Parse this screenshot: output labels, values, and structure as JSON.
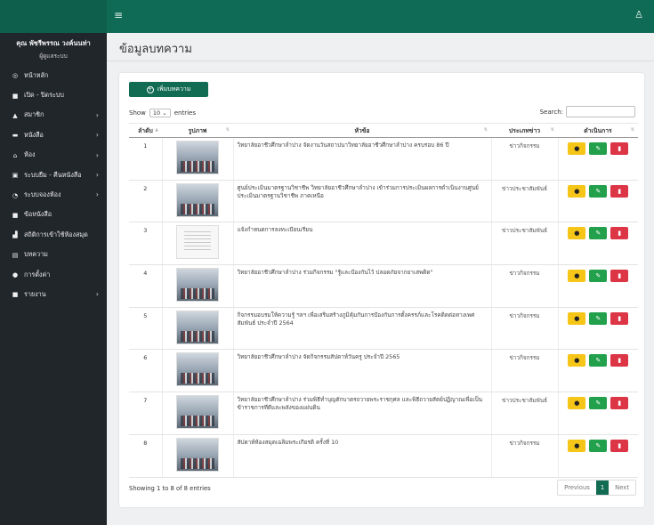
{
  "topbar": {
    "menu_icon": "hamburger-menu-icon",
    "user_icon": "user-icon"
  },
  "sidebar": {
    "user_name": "คุณ พัชรีพรรณ วงค์นนท่า",
    "user_role": "ผู้ดูแลระบบ",
    "items": [
      {
        "label": "หน้าหลัก",
        "icon": "dashboard-icon",
        "glyph": "◎",
        "has_submenu": false
      },
      {
        "label": "เปิด - ปิดระบบ",
        "icon": "file-icon",
        "glyph": "■",
        "has_submenu": false
      },
      {
        "label": "สมาชิก",
        "icon": "users-icon",
        "glyph": "▲",
        "has_submenu": true
      },
      {
        "label": "หนังสือ",
        "icon": "book-icon",
        "glyph": "▬",
        "has_submenu": true
      },
      {
        "label": "ห้อง",
        "icon": "room-icon",
        "glyph": "⌂",
        "has_submenu": true
      },
      {
        "label": "ระบบยืม - คืนหนังสือ",
        "icon": "borrow-icon",
        "glyph": "▣",
        "has_submenu": true
      },
      {
        "label": "ระบบจองห้อง",
        "icon": "booking-icon",
        "glyph": "◔",
        "has_submenu": true
      },
      {
        "label": "ข้อหนังสือ",
        "icon": "document-icon",
        "glyph": "■",
        "has_submenu": false
      },
      {
        "label": "สถิติการเข้าใช้ห้องสมุด",
        "icon": "stats-icon",
        "glyph": "▟",
        "has_submenu": false
      },
      {
        "label": "บทความ",
        "icon": "article-icon",
        "glyph": "▤",
        "has_submenu": false
      },
      {
        "label": "การตั้งค่า",
        "icon": "settings-icon",
        "glyph": "●",
        "has_submenu": false
      },
      {
        "label": "รายงาน",
        "icon": "report-icon",
        "glyph": "■",
        "has_submenu": true
      }
    ]
  },
  "page": {
    "title": "ข้อมูลบทความ"
  },
  "toolbar": {
    "add_label": "เพิ่มบทความ"
  },
  "table_controls": {
    "show_label": "Show",
    "page_size": "10",
    "entries_label": "entries",
    "search_label": "Search:"
  },
  "table": {
    "headers": [
      "ลำดับ",
      "รูปภาพ",
      "หัวข้อ",
      "ประเภทข่าว",
      "ดำเนินการ"
    ],
    "rows": [
      {
        "no": "1",
        "thumb": "photo",
        "title": "วิทยาลัยอาชีวศึกษาลำปาง จัดงานวันสถาปนาวิทยาลัยอาชีวศึกษาลำปาง ครบรอบ 86 ปี",
        "category": "ข่าวกิจกรรม"
      },
      {
        "no": "2",
        "thumb": "photo",
        "title": "ศูนย์ประเมินมาตรฐานวิชาชีพ วิทยาลัยอาชีวศึกษาลำปาง เข้าร่วมการประเมินผลการดำเนินงานศูนย์ประเมินมาตรฐานวิชาชีพ ภาคเหนือ",
        "category": "ข่าวประชาสัมพันธ์"
      },
      {
        "no": "3",
        "thumb": "doc",
        "title": "แจ้งกำหนดการลงทะเบียนเรียน",
        "category": "ข่าวประชาสัมพันธ์"
      },
      {
        "no": "4",
        "thumb": "photo",
        "title": "วิทยาลัยอาชีวศึกษาลำปาง ร่วมกิจกรรม \"รู้และป้องกันไว้ ปลอดภัยจากยาเสพติด\"",
        "category": "ข่าวกิจกรรม"
      },
      {
        "no": "5",
        "thumb": "photo",
        "title": "กิจกรรมอบรมให้ความรู้ ฯลฯ เพื่อเสริมสร้างภูมิคุ้มกันการป้องกันการตั้งครรภ์และโรคติดต่อทางเพศสัมพันธ์ ประจำปี 2564",
        "category": "ข่าวกิจกรรม"
      },
      {
        "no": "6",
        "thumb": "photo",
        "title": "วิทยาลัยอาชีวศึกษาลำปาง จัดกิจกรรมสัปดาห์วันครู ประจำปี 2565",
        "category": "ข่าวกิจกรรม"
      },
      {
        "no": "7",
        "thumb": "photo",
        "title": "วิทยาลัยอาชีวศึกษาลำปาง ร่วมพิธีทำบุญตักบาตรถวายพระราชกุศล และพิธีถวายสัตย์ปฏิญาณเพื่อเป็นข้าราชการที่ดีและพลังของแผ่นดิน",
        "category": "ข่าวประชาสัมพันธ์"
      },
      {
        "no": "8",
        "thumb": "photo",
        "title": "สัปดาห์ห้องสมุดเฉลิมพระเกียรติ ครั้งที่ 10",
        "category": "ข่าวกิจกรรม"
      }
    ]
  },
  "footer": {
    "info": "Showing 1 to 8 of 8 entries",
    "prev": "Previous",
    "page": "1",
    "next": "Next"
  },
  "colors": {
    "topbar": "#0f6b55",
    "sidebar": "#21262b",
    "view_button": "#f5c518",
    "edit_button": "#22a04b",
    "delete_button": "#dc3545"
  }
}
